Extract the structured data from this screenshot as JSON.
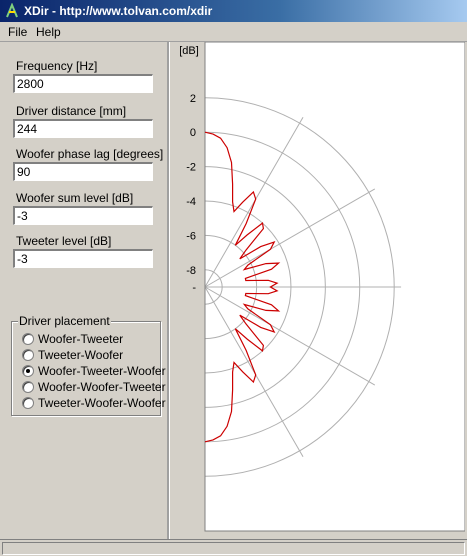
{
  "window": {
    "title": "XDir - http://www.tolvan.com/xdir"
  },
  "menu": {
    "file": "File",
    "help": "Help"
  },
  "form": {
    "frequency": {
      "label": "Frequency [Hz]",
      "value": "2800"
    },
    "driver_distance": {
      "label": "Driver distance [mm]",
      "value": "244"
    },
    "woofer_phase_lag": {
      "label": "Woofer phase lag [degrees]",
      "value": "90"
    },
    "woofer_sum_level": {
      "label": "Woofer sum level [dB]",
      "value": "-3"
    },
    "tweeter_level": {
      "label": "Tweeter level [dB]",
      "value": "-3"
    }
  },
  "placement": {
    "title": "Driver placement",
    "options": [
      "Woofer-Tweeter",
      "Tweeter-Woofer",
      "Woofer-Tweeter-Woofer",
      "Woofer-Woofer-Tweeter",
      "Tweeter-Woofer-Woofer"
    ],
    "selected": 2
  },
  "colors": {
    "curve": "#cc0000",
    "grid": "#b0b0b0",
    "plot_bg": "#ffffff"
  },
  "chart_data": {
    "type": "line",
    "plot": "polar-half",
    "unit_label": "[dB]",
    "r_ticks": [
      "2",
      "0",
      "-2",
      "-4",
      "-6",
      "-8",
      "-"
    ],
    "r_values": [
      2,
      0,
      -2,
      -4,
      -6,
      -8
    ],
    "angle_spokes_deg": [
      -90,
      -60,
      -30,
      0,
      30,
      60,
      90
    ],
    "series": [
      {
        "angle_deg": [
          -90,
          -87,
          -84,
          -81,
          -78,
          -75,
          -72,
          -69,
          -66,
          -63,
          -60,
          -57,
          -54,
          -51,
          -48,
          -45,
          -42,
          -39,
          -36,
          -33,
          -30,
          -27,
          -24,
          -21,
          -18,
          -15,
          -12,
          -9,
          -6,
          -3,
          0,
          3,
          6,
          9,
          12,
          15,
          18,
          21,
          24,
          27,
          30,
          33,
          36,
          39,
          42,
          45,
          48,
          51,
          54,
          57,
          60,
          63,
          66,
          69,
          72,
          75,
          78,
          81,
          84,
          87,
          90
        ],
        "level_db": [
          0.0,
          -0.1,
          -0.3,
          -0.8,
          -1.6,
          -2.8,
          -3.8,
          -4.3,
          -3.6,
          -2.8,
          -3.1,
          -4.6,
          -6.0,
          -5.1,
          -4.0,
          -4.2,
          -5.8,
          -6.4,
          -5.0,
          -4.2,
          -4.6,
          -6.2,
          -6.5,
          -5.2,
          -4.5,
          -5.0,
          -6.6,
          -6.6,
          -5.3,
          -4.8,
          -5.2,
          -4.8,
          -5.3,
          -6.6,
          -6.6,
          -5.0,
          -4.5,
          -5.2,
          -6.5,
          -6.2,
          -4.6,
          -4.2,
          -5.0,
          -6.4,
          -5.8,
          -4.2,
          -4.0,
          -5.1,
          -6.0,
          -4.6,
          -3.1,
          -2.8,
          -3.6,
          -4.3,
          -3.8,
          -2.8,
          -1.6,
          -0.8,
          -0.3,
          -0.1,
          0.0
        ]
      }
    ]
  }
}
